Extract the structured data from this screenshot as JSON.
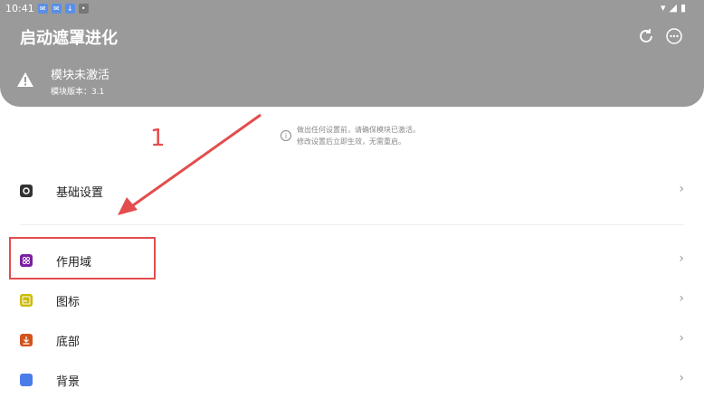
{
  "status_bar": {
    "time": "10:41"
  },
  "app": {
    "title": "启动遮罩进化"
  },
  "warning": {
    "title": "模块未激活",
    "subtitle": "模块版本：3.1"
  },
  "notice": {
    "line1": "做出任何设置前，请确保模块已激活。",
    "line2": "修改设置后立即生效，无需重启。"
  },
  "settings": [
    {
      "label": "基础设置",
      "icon": "gear-icon",
      "color": "#333333"
    },
    {
      "label": "作用域",
      "icon": "scope-icon",
      "color": "#7a1fa2"
    },
    {
      "label": "图标",
      "icon": "image-icon",
      "color": "#c9b900"
    },
    {
      "label": "底部",
      "icon": "download-icon",
      "color": "#d2531b"
    },
    {
      "label": "背景",
      "icon": "background-icon",
      "color": "#4a7de8"
    }
  ],
  "annotation": {
    "number": "1",
    "color": "#e34d4d"
  }
}
